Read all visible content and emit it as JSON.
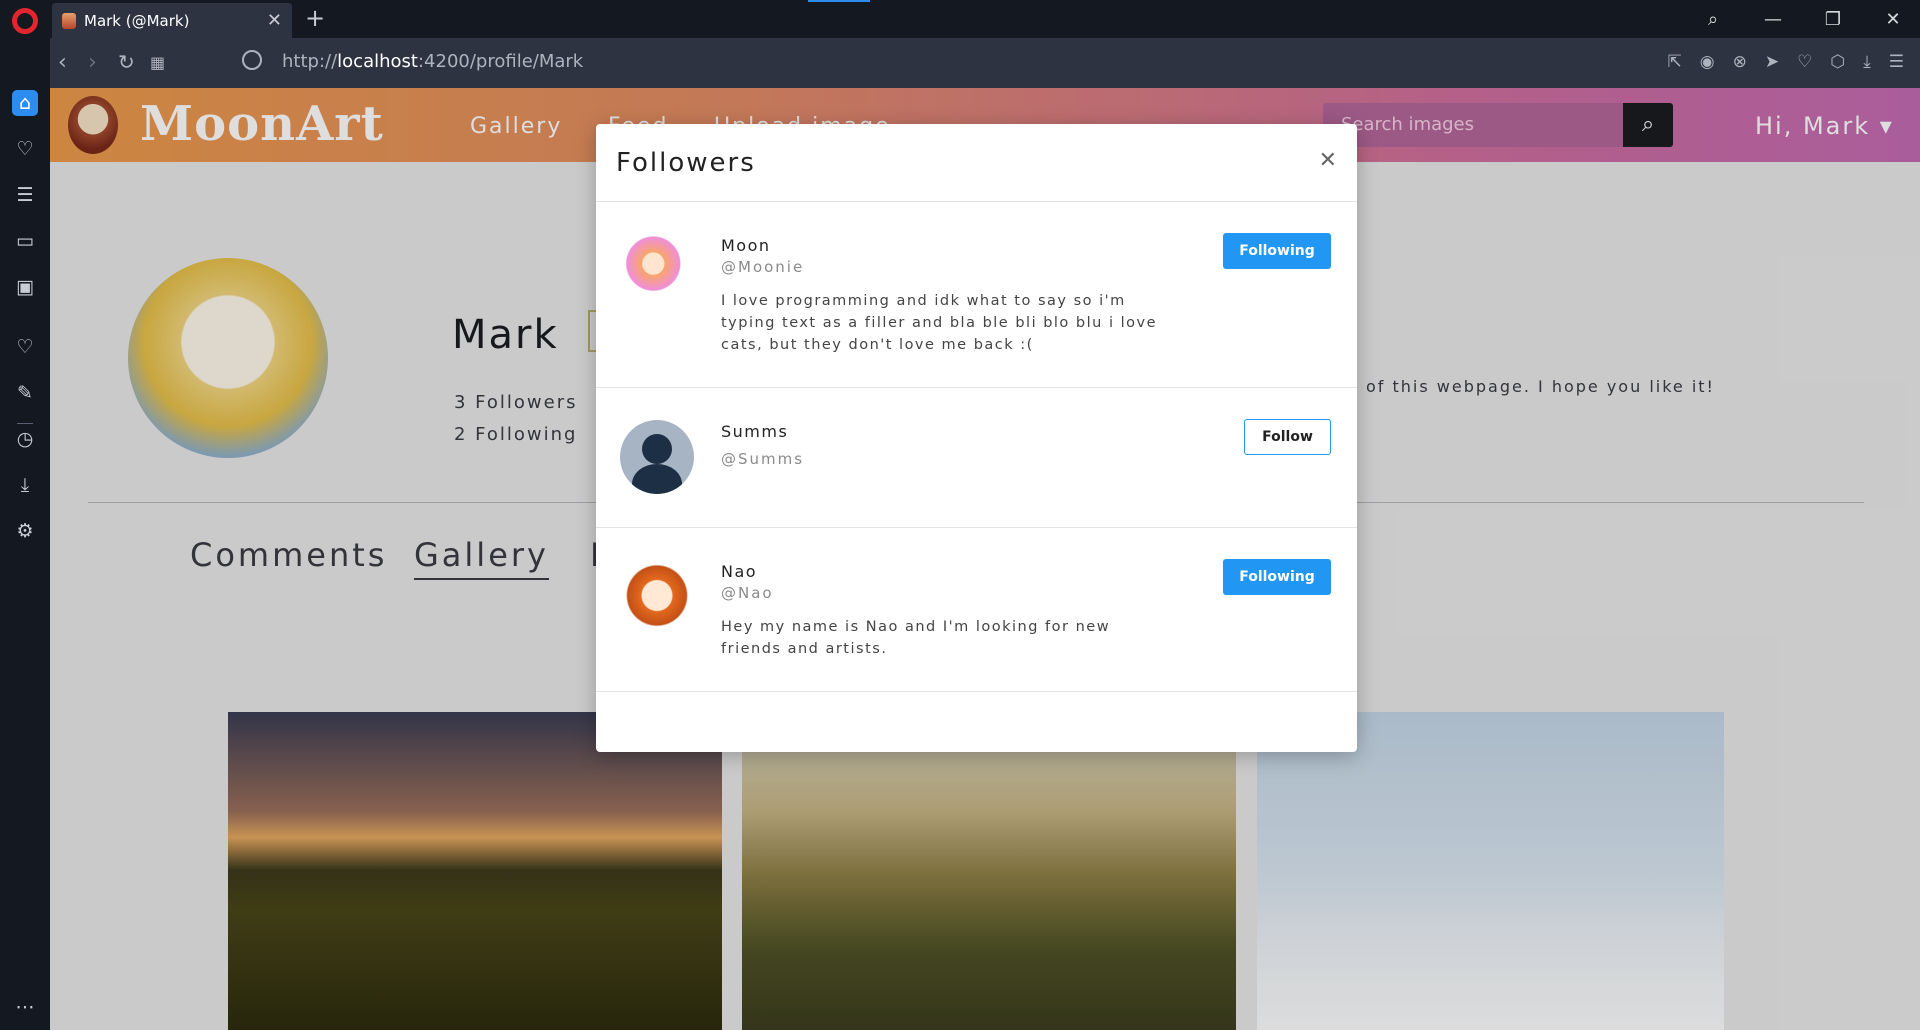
{
  "browser": {
    "tab_title": "Mark (@Mark)",
    "url_prefix": "http://",
    "url_host": "localhost",
    "url_path": ":4200/profile/Mark"
  },
  "site": {
    "logo": "MoonArt",
    "nav": [
      "Gallery",
      "Feed",
      "Upload image"
    ],
    "search_placeholder": "Search images",
    "greeting": "Hi,  Mark ▾"
  },
  "profile": {
    "name": "Mark",
    "followers": "3 Followers",
    "following": "2 Following",
    "bio_fragment": "of this webpage. I hope you like it!",
    "tabs": [
      "Comments",
      "Gallery",
      "L"
    ]
  },
  "modal": {
    "title": "Followers",
    "followers": [
      {
        "name": "Moon",
        "handle": "@Moonie",
        "bio": "I love programming and idk what to say so i'm typing text as a filler and bla ble bli blo blu i love cats, but they don't love me back :(",
        "button": "Following"
      },
      {
        "name": "Summs",
        "handle": "@Summs",
        "bio": "",
        "button": "Follow"
      },
      {
        "name": "Nao",
        "handle": "@Nao",
        "bio": "Hey my name is Nao and I'm looking for new friends and artists.",
        "button": "Following"
      }
    ]
  },
  "colors": {
    "accent": "#2196f3",
    "opera_red": "#e3262e",
    "nav_gradient_start": "#ec9a4b",
    "nav_gradient_end": "#c46bb3"
  }
}
